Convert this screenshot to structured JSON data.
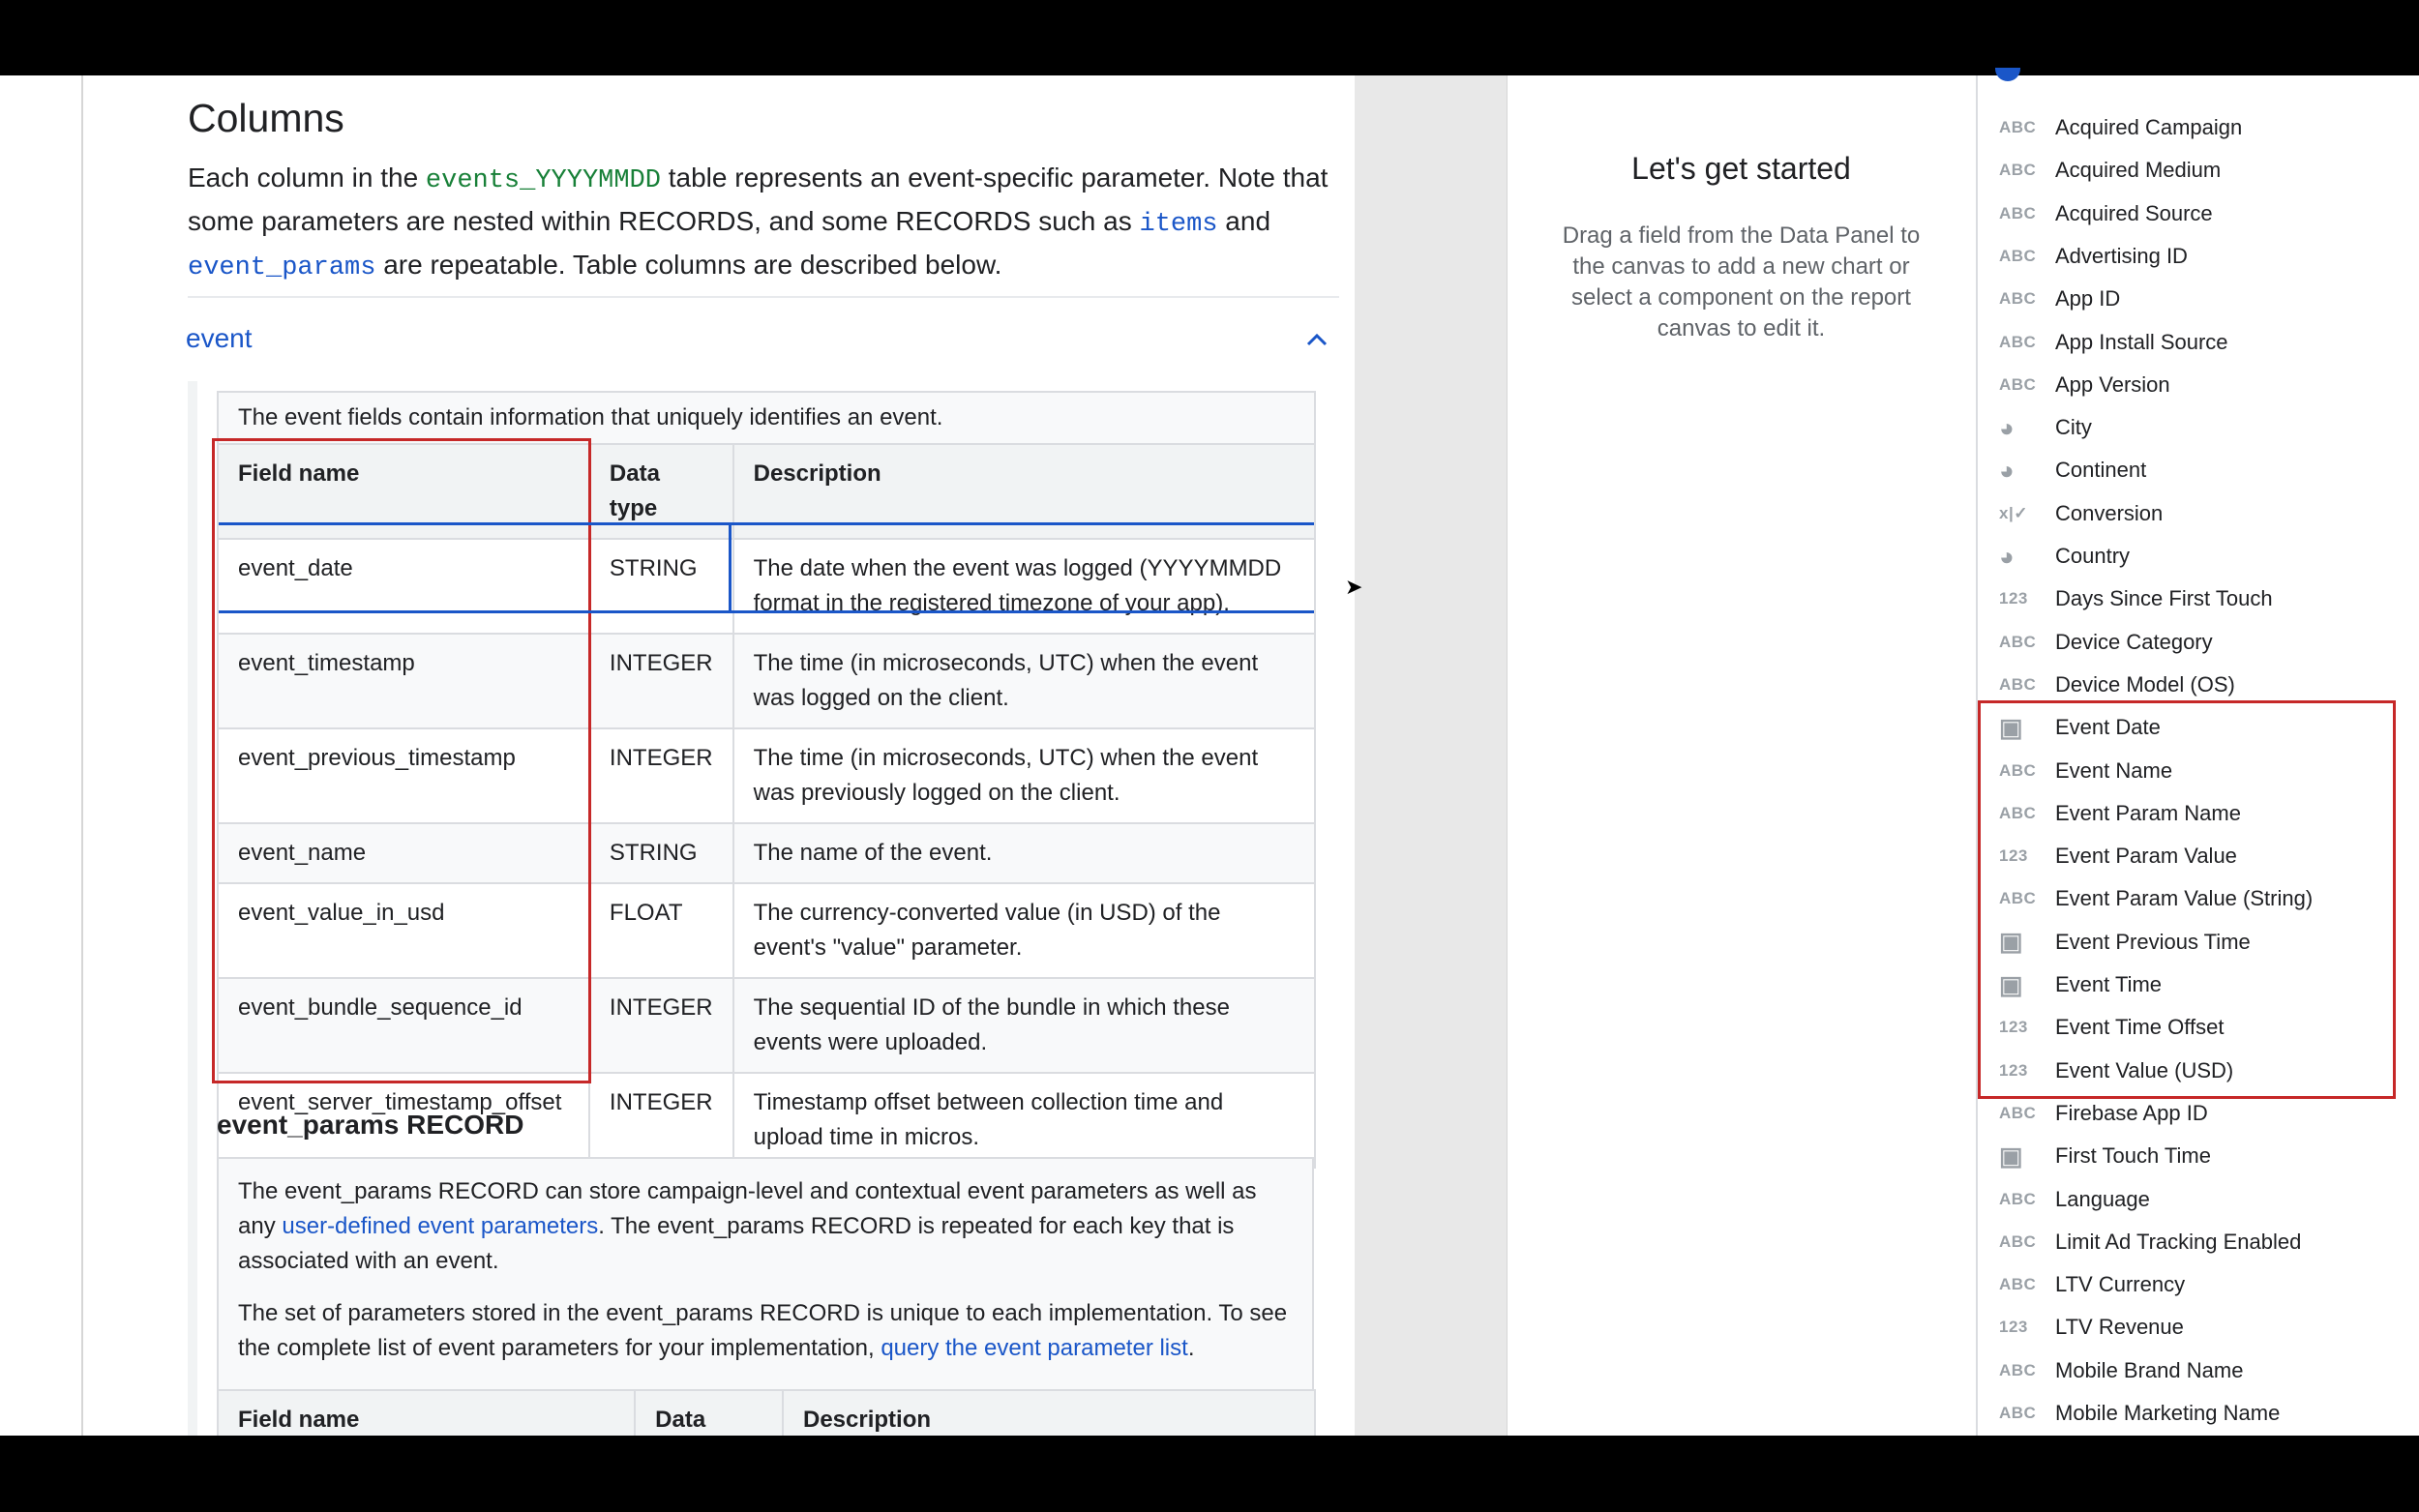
{
  "doc": {
    "heading": "Columns",
    "intro": {
      "p1": "Each column in the ",
      "table_code": "events_YYYYMMDD",
      "p2": " table represents an event-specific parameter. Note that",
      "p3": "some parameters are nested within RECORDS, and some RECORDS such as ",
      "items_code": "items",
      "p4": " and",
      "params_code": "event_params",
      "p5": " are repeatable. Table columns are described below."
    },
    "section_link": "event",
    "event_table": {
      "caption": "The event fields contain information that uniquely identifies an event.",
      "headers": [
        "Field name",
        "Data type",
        "Description"
      ],
      "rows": [
        {
          "field": "event_date",
          "type": "STRING",
          "desc": "The date when the event was logged (YYYYMMDD format in the registered timezone of your app)."
        },
        {
          "field": "event_timestamp",
          "type": "INTEGER",
          "desc": "The time (in microseconds, UTC) when the event was logged on the client."
        },
        {
          "field": "event_previous_timestamp",
          "type": "INTEGER",
          "desc": "The time (in microseconds, UTC) when the event was previously logged on the client."
        },
        {
          "field": "event_name",
          "type": "STRING",
          "desc": "The name of the event."
        },
        {
          "field": "event_value_in_usd",
          "type": "FLOAT",
          "desc": "The currency-converted value (in USD) of the event's \"value\" parameter."
        },
        {
          "field": "event_bundle_sequence_id",
          "type": "INTEGER",
          "desc": "The sequential ID of the bundle in which these events were uploaded."
        },
        {
          "field": "event_server_timestamp_offset",
          "type": "INTEGER",
          "desc": "Timestamp offset between collection time and upload time in micros."
        }
      ]
    },
    "params": {
      "heading": "event_params RECORD",
      "p1a": "The event_params RECORD can store campaign-level and contextual event parameters as well as any ",
      "p1_link": "user-defined event parameters",
      "p1b": ". The event_params RECORD is repeated for each key that is associated with an event.",
      "p2a": "The set of parameters stored in the event_params RECORD is unique to each implementation. To see the complete list of event parameters for your implementation, ",
      "p2_link": "query the event parameter list",
      "p2b": ".",
      "headers": [
        "Field name",
        "Data",
        "Description"
      ]
    }
  },
  "center": {
    "title": "Let's get started",
    "body": "Drag a field from the Data Panel to the canvas to add a new chart or select a component on the report canvas to edit it."
  },
  "fields": [
    {
      "icon": "ABC",
      "label": "Acquired Campaign"
    },
    {
      "icon": "ABC",
      "label": "Acquired Medium"
    },
    {
      "icon": "ABC",
      "label": "Acquired Source"
    },
    {
      "icon": "ABC",
      "label": "Advertising ID"
    },
    {
      "icon": "ABC",
      "label": "App ID"
    },
    {
      "icon": "ABC",
      "label": "App Install Source"
    },
    {
      "icon": "ABC",
      "label": "App Version"
    },
    {
      "icon": "globe",
      "label": "City"
    },
    {
      "icon": "globe",
      "label": "Continent"
    },
    {
      "icon": "x|✓",
      "label": "Conversion"
    },
    {
      "icon": "globe",
      "label": "Country"
    },
    {
      "icon": "123",
      "label": "Days Since First Touch"
    },
    {
      "icon": "ABC",
      "label": "Device Category"
    },
    {
      "icon": "ABC",
      "label": "Device Model (OS)"
    },
    {
      "icon": "calendar",
      "label": "Event Date"
    },
    {
      "icon": "ABC",
      "label": "Event Name"
    },
    {
      "icon": "ABC",
      "label": "Event Param Name"
    },
    {
      "icon": "123",
      "label": "Event Param Value"
    },
    {
      "icon": "ABC",
      "label": "Event Param Value (String)"
    },
    {
      "icon": "calendar",
      "label": "Event Previous Time"
    },
    {
      "icon": "calendar",
      "label": "Event Time"
    },
    {
      "icon": "123",
      "label": "Event Time Offset"
    },
    {
      "icon": "123",
      "label": "Event Value (USD)"
    },
    {
      "icon": "ABC",
      "label": "Firebase App ID"
    },
    {
      "icon": "calendar",
      "label": "First Touch Time"
    },
    {
      "icon": "ABC",
      "label": "Language"
    },
    {
      "icon": "ABC",
      "label": "Limit Ad Tracking Enabled"
    },
    {
      "icon": "ABC",
      "label": "LTV Currency"
    },
    {
      "icon": "123",
      "label": "LTV Revenue"
    },
    {
      "icon": "ABC",
      "label": "Mobile Brand Name"
    },
    {
      "icon": "ABC",
      "label": "Mobile Marketing Name"
    }
  ],
  "colors": {
    "link": "#1a56c8",
    "code_green": "#188038",
    "highlight_red": "#c62828"
  }
}
